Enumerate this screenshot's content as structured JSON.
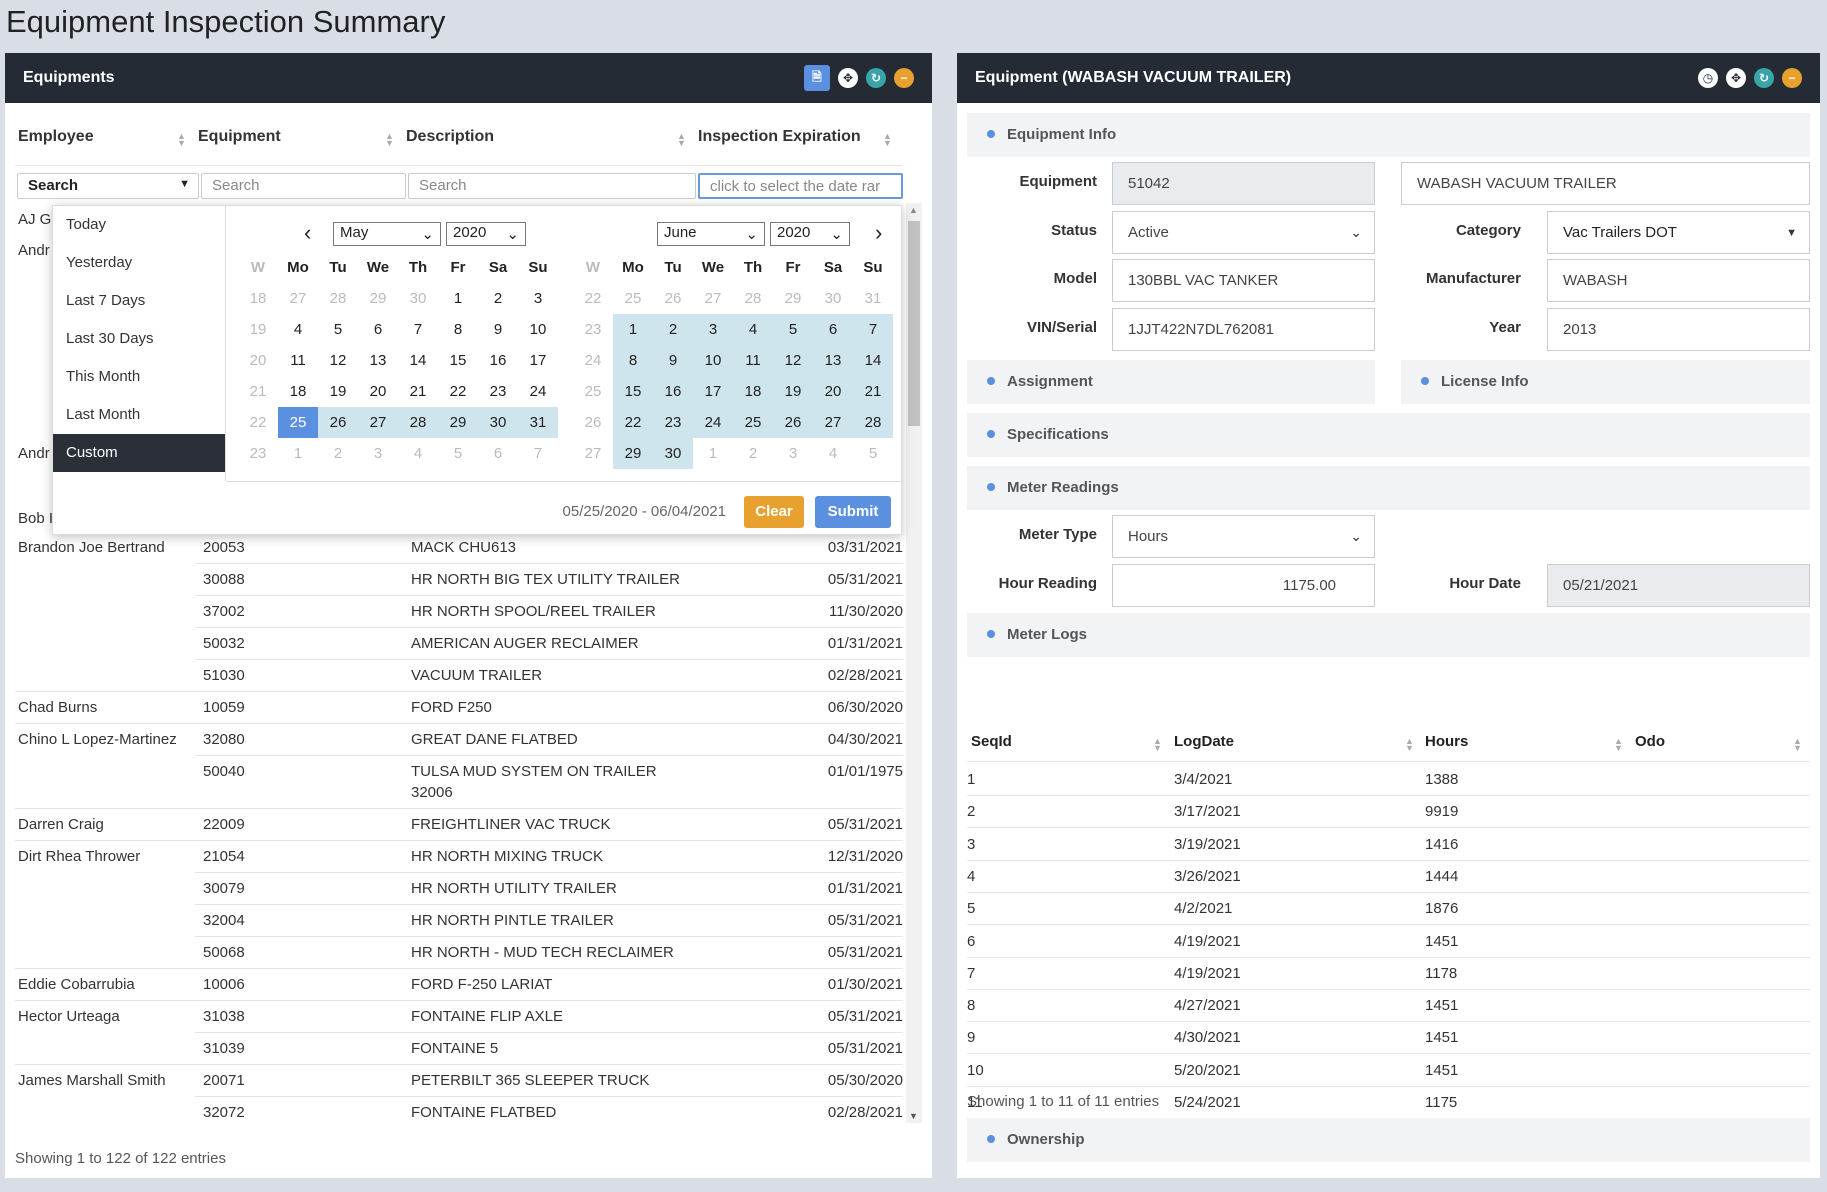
{
  "page_title": "Equipment Inspection Summary",
  "left_panel": {
    "title": "Equipments",
    "icons": [
      "document-icon",
      "expand-icon",
      "refresh-icon",
      "minimize-icon"
    ],
    "columns": [
      "Employee",
      "Equipment",
      "Description",
      "Inspection Expiration"
    ],
    "search": {
      "employee": "Search",
      "equipment": "Search",
      "description": "Search",
      "expiration": "click to select the date rar"
    },
    "partial_rows": [
      "AJ G",
      "Andr",
      "Andr",
      "Bob I"
    ],
    "rows": [
      {
        "employee": "Brandon Joe Bertrand",
        "equipment": "20053",
        "description": "MACK CHU613",
        "date": "03/31/2021"
      },
      {
        "employee": "",
        "equipment": "30088",
        "description": "HR NORTH BIG TEX UTILITY TRAILER",
        "date": "05/31/2021"
      },
      {
        "employee": "",
        "equipment": "37002",
        "description": "HR NORTH SPOOL/REEL TRAILER",
        "date": "11/30/2020"
      },
      {
        "employee": "",
        "equipment": "50032",
        "description": "AMERICAN AUGER RECLAIMER",
        "date": "01/31/2021"
      },
      {
        "employee": "",
        "equipment": "51030",
        "description": "VACUUM TRAILER",
        "date": "02/28/2021"
      },
      {
        "employee": "Chad Burns",
        "equipment": "10059",
        "description": "FORD F250",
        "date": "06/30/2020"
      },
      {
        "employee": "Chino L Lopez-Martinez",
        "equipment": "32080",
        "description": "GREAT DANE FLATBED",
        "date": "04/30/2021"
      },
      {
        "employee": "",
        "equipment": "50040",
        "description": "TULSA MUD SYSTEM ON TRAILER",
        "description2": "32006",
        "date": "01/01/1975"
      },
      {
        "employee": "Darren Craig",
        "equipment": "22009",
        "description": "FREIGHTLINER VAC TRUCK",
        "date": "05/31/2021"
      },
      {
        "employee": "Dirt Rhea Thrower",
        "equipment": "21054",
        "description": "HR NORTH MIXING TRUCK",
        "date": "12/31/2020"
      },
      {
        "employee": "",
        "equipment": "30079",
        "description": "HR NORTH UTILITY TRAILER",
        "date": "01/31/2021"
      },
      {
        "employee": "",
        "equipment": "32004",
        "description": "HR NORTH PINTLE TRAILER",
        "date": "05/31/2021"
      },
      {
        "employee": "",
        "equipment": "50068",
        "description": "HR NORTH - MUD TECH RECLAIMER",
        "date": "05/31/2021"
      },
      {
        "employee": "Eddie Cobarrubia",
        "equipment": "10006",
        "description": "FORD F-250 LARIAT",
        "date": "01/30/2021"
      },
      {
        "employee": "Hector Urteaga",
        "equipment": "31038",
        "description": "FONTAINE FLIP AXLE",
        "date": "05/31/2021"
      },
      {
        "employee": "",
        "equipment": "31039",
        "description": "FONTAINE 5",
        "date": "05/31/2021"
      },
      {
        "employee": "James Marshall Smith",
        "equipment": "20071",
        "description": "PETERBILT 365 SLEEPER TRUCK",
        "date": "05/30/2020"
      },
      {
        "employee": "",
        "equipment": "32072",
        "description": "FONTAINE FLATBED",
        "date": "02/28/2021"
      }
    ],
    "footer": "Showing 1 to 122 of 122 entries"
  },
  "date_picker": {
    "ranges": [
      "Today",
      "Yesterday",
      "Last 7 Days",
      "Last 30 Days",
      "This Month",
      "Last Month",
      "Custom"
    ],
    "active_range": "Custom",
    "day_headers": [
      "W",
      "Mo",
      "Tu",
      "We",
      "Th",
      "Fr",
      "Sa",
      "Su"
    ],
    "left_month": "May",
    "left_year": "2020",
    "right_month": "June",
    "right_year": "2020",
    "left_weeks": [
      [
        "18",
        "27",
        "28",
        "29",
        "30",
        "1",
        "2",
        "3"
      ],
      [
        "19",
        "4",
        "5",
        "6",
        "7",
        "8",
        "9",
        "10"
      ],
      [
        "20",
        "11",
        "12",
        "13",
        "14",
        "15",
        "16",
        "17"
      ],
      [
        "21",
        "18",
        "19",
        "20",
        "21",
        "22",
        "23",
        "24"
      ],
      [
        "22",
        "25",
        "26",
        "27",
        "28",
        "29",
        "30",
        "31"
      ],
      [
        "23",
        "1",
        "2",
        "3",
        "4",
        "5",
        "6",
        "7"
      ]
    ],
    "right_weeks": [
      [
        "22",
        "25",
        "26",
        "27",
        "28",
        "29",
        "30",
        "31"
      ],
      [
        "23",
        "1",
        "2",
        "3",
        "4",
        "5",
        "6",
        "7"
      ],
      [
        "24",
        "8",
        "9",
        "10",
        "11",
        "12",
        "13",
        "14"
      ],
      [
        "25",
        "15",
        "16",
        "17",
        "18",
        "19",
        "20",
        "21"
      ],
      [
        "26",
        "22",
        "23",
        "24",
        "25",
        "26",
        "27",
        "28"
      ],
      [
        "27",
        "29",
        "30",
        "1",
        "2",
        "3",
        "4",
        "5"
      ]
    ],
    "range_text": "05/25/2020 - 06/04/2021",
    "clear_label": "Clear",
    "submit_label": "Submit",
    "colors": {
      "selected": "#5b8fe0",
      "in_range": "#cfe5ee",
      "clear": "#e8a12e",
      "submit": "#5b8fe0"
    }
  },
  "right_panel": {
    "title": "Equipment (WABASH VACUUM TRAILER)",
    "icons": [
      "history-icon",
      "expand-icon",
      "refresh-icon",
      "minimize-icon"
    ],
    "sections": {
      "info": "Equipment Info",
      "assignment": "Assignment",
      "license": "License Info",
      "specs": "Specifications",
      "meter_readings": "Meter Readings",
      "meter_logs": "Meter Logs",
      "ownership": "Ownership"
    },
    "fields": {
      "equipment_label": "Equipment",
      "equipment_value": "51042",
      "equipment_name": "WABASH VACUUM TRAILER",
      "status_label": "Status",
      "status_value": "Active",
      "category_label": "Category",
      "category_value": "Vac Trailers DOT",
      "model_label": "Model",
      "model_value": "130BBL VAC TANKER",
      "manufacturer_label": "Manufacturer",
      "manufacturer_value": "WABASH",
      "vin_label": "VIN/Serial",
      "vin_value": "1JJT422N7DL762081",
      "year_label": "Year",
      "year_value": "2013",
      "meter_type_label": "Meter Type",
      "meter_type_value": "Hours",
      "hour_reading_label": "Hour Reading",
      "hour_reading_value": "1175.00",
      "hour_date_label": "Hour Date",
      "hour_date_value": "05/21/2021"
    },
    "log_columns": [
      "SeqId",
      "LogDate",
      "Hours",
      "Odo"
    ],
    "logs": [
      {
        "seq": "1",
        "date": "3/4/2021",
        "hours": "1388"
      },
      {
        "seq": "2",
        "date": "3/17/2021",
        "hours": "9919"
      },
      {
        "seq": "3",
        "date": "3/19/2021",
        "hours": "1416"
      },
      {
        "seq": "4",
        "date": "3/26/2021",
        "hours": "1444"
      },
      {
        "seq": "5",
        "date": "4/2/2021",
        "hours": "1876"
      },
      {
        "seq": "6",
        "date": "4/19/2021",
        "hours": "1451"
      },
      {
        "seq": "7",
        "date": "4/19/2021",
        "hours": "1178"
      },
      {
        "seq": "8",
        "date": "4/27/2021",
        "hours": "1451"
      },
      {
        "seq": "9",
        "date": "4/30/2021",
        "hours": "1451"
      },
      {
        "seq": "10",
        "date": "5/20/2021",
        "hours": "1451"
      },
      {
        "seq": "11",
        "date": "5/24/2021",
        "hours": "1175"
      }
    ],
    "logs_footer": "Showing 1 to 11 of 11 entries"
  }
}
